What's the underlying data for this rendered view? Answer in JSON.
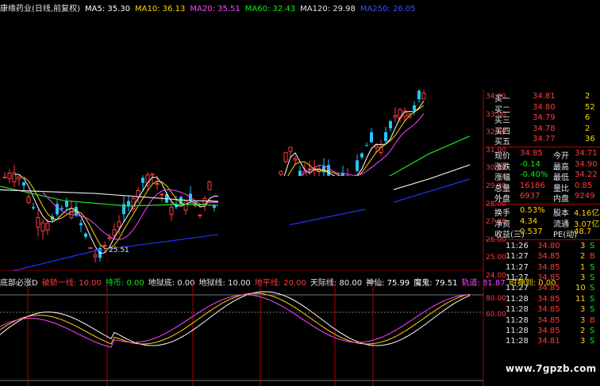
{
  "header": {
    "stock_period": "康缘药业(日线,前复权)",
    "ma_items": [
      {
        "label": "MA5: 35.30",
        "color": "#ffffff"
      },
      {
        "label": "MA10: 36.13",
        "color": "#ffd400"
      },
      {
        "label": "MA20: 35.51",
        "color": "#ff44ff"
      },
      {
        "label": "MA60: 32.43",
        "color": "#19e619"
      },
      {
        "label": "MA120: 29.98",
        "color": "#e6e6e6"
      },
      {
        "label": "MA250: 26.05",
        "color": "#3355ff"
      }
    ]
  },
  "price_axis": {
    "ticks": [
      "34.00",
      "33.00",
      "32.00",
      "31.00",
      "30.00",
      "29.00",
      "28.00",
      "27.00",
      "26.00",
      "25.00",
      "24.00"
    ]
  },
  "low_marker": "25.51",
  "order_book": [
    {
      "label": "买一",
      "price": "34.81",
      "vol": "2"
    },
    {
      "label": "买二",
      "price": "34.80",
      "vol": "52"
    },
    {
      "label": "买三",
      "price": "34.79",
      "vol": "6"
    },
    {
      "label": "买四",
      "price": "34.78",
      "vol": "2"
    },
    {
      "label": "买五",
      "price": "34.77",
      "vol": "36"
    }
  ],
  "quote_stats": [
    {
      "l1": "现价",
      "v1": "34.85",
      "l2": "今开",
      "v2": "34.71"
    },
    {
      "l1": "涨跌",
      "v1": "-0.14",
      "l2": "最高",
      "v2": "34.90"
    },
    {
      "l1": "涨幅",
      "v1": "-0.40%",
      "l2": "最低",
      "v2": "34.22"
    },
    {
      "l1": "总量",
      "v1": "16186",
      "l2": "量比",
      "v2": "0.85"
    },
    {
      "l1": "外盘",
      "v1": "6937",
      "l2": "内盘",
      "v2": "9249"
    }
  ],
  "fin_stats": [
    {
      "l1": "换手",
      "v1": "0.53%",
      "l2": "股本",
      "v2": "4.16亿"
    },
    {
      "l1": "净资",
      "v1": "4.34",
      "l2": "流通",
      "v2": "3.07亿"
    },
    {
      "l1": "收益(三)",
      "v1": "0.537",
      "l2": "PE(动)",
      "v2": "48.7"
    }
  ],
  "ticks": [
    {
      "time": "11:26",
      "price": "34.80",
      "vol": "3",
      "side": "S"
    },
    {
      "time": "11:27",
      "price": "34.85",
      "vol": "2",
      "side": "B"
    },
    {
      "time": "11:27",
      "price": "34.85",
      "vol": "1",
      "side": "S"
    },
    {
      "time": "11:27",
      "price": "34.85",
      "vol": "3",
      "side": "S"
    },
    {
      "time": "11:27",
      "price": "34.85",
      "vol": "10",
      "side": "S"
    },
    {
      "time": "11:28",
      "price": "34.85",
      "vol": "11",
      "side": "S"
    },
    {
      "time": "11:28",
      "price": "34.85",
      "vol": "3",
      "side": "S"
    },
    {
      "time": "11:28",
      "price": "34.85",
      "vol": "3",
      "side": "B"
    },
    {
      "time": "11:28",
      "price": "34.85",
      "vol": "2",
      "side": "S"
    },
    {
      "time": "11:28",
      "price": "34.81",
      "vol": "3",
      "side": "S"
    }
  ],
  "indicator": {
    "name": "底部必涨D",
    "items": [
      {
        "label": "破轿一线: 10.00",
        "color": "#ff3b3b"
      },
      {
        "label": "持币: 0.00",
        "color": "#19e619"
      },
      {
        "label": "地狱底: 0.00",
        "color": "#e6e6e6"
      },
      {
        "label": "地狱线: 10.00",
        "color": "#e6e6e6"
      },
      {
        "label": "地平线: 20.00",
        "color": "#ff3b3b"
      },
      {
        "label": "天际线: 80.00",
        "color": "#e6e6e6"
      },
      {
        "label": "神仙: 75.99",
        "color": "#ffffff"
      },
      {
        "label": "魔鬼: 79.51",
        "color": "#ffffff"
      },
      {
        "label": "轨道: 81.87",
        "color": "#ff44ff"
      },
      {
        "label": "时神到: 0.00",
        "color": "#ffd400"
      }
    ],
    "axis_ticks": [
      "80.00",
      "60.00"
    ]
  },
  "watermark": "www.7gpzb.com"
}
